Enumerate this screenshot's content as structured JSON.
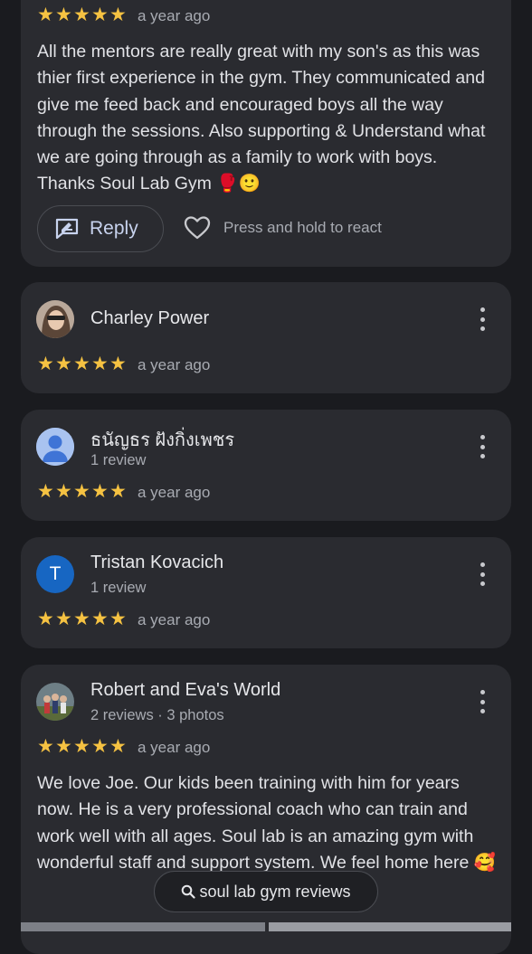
{
  "colors": {
    "background": "#1a1b1f",
    "card": "#2a2b30",
    "star": "#f5c242",
    "secondary_text": "#a8abb2",
    "accent": "#c8d3ee"
  },
  "first_review": {
    "stars": 5,
    "time": "a year ago",
    "text": "All the mentors are really great with my son's as this was thier first experience in the gym. They communicated and give me feed back and encouraged boys all the way through the sessions. Also supporting & Understand what we are going through as a family to work with boys. Thanks Soul Lab Gym 🥊🙂",
    "reply_label": "Reply",
    "react_hint": "Press and hold to react"
  },
  "reviews": [
    {
      "name": "Charley Power",
      "meta": "",
      "stars": 5,
      "time": "a year ago",
      "avatar": "photo"
    },
    {
      "name": "ธนัญธร ฝังกิ่งเพชร",
      "meta": "1 review",
      "stars": 5,
      "time": "a year ago",
      "avatar": "person-icon"
    },
    {
      "name": "Tristan Kovacich",
      "meta": "1 review",
      "stars": 5,
      "time": "a year ago",
      "avatar": "T"
    },
    {
      "name": "Robert and Eva's World",
      "meta": "2 reviews · 3 photos",
      "stars": 5,
      "time": "a year ago",
      "avatar": "photo",
      "text": "We love Joe. Our kids been training with him for years now. He is a very professional coach who can train and work well with all ages. Soul lab is an amazing gym with wonderful staff and support system. We feel home here 🥰"
    }
  ],
  "search": {
    "query": "soul lab gym reviews",
    "icon": "search-icon"
  }
}
